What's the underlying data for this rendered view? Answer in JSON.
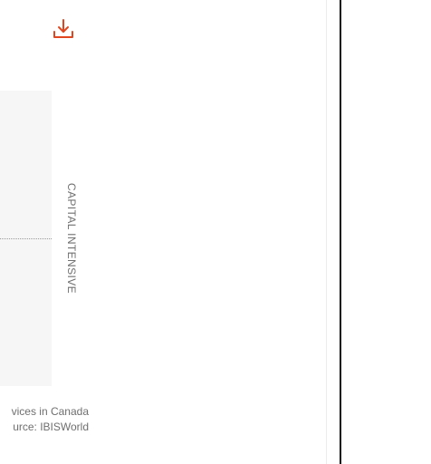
{
  "icons": {
    "download": "download-icon"
  },
  "colors": {
    "accent": "#e0461f",
    "plot_background": "#f6f6f6",
    "label_gray": "#707070",
    "divider": "#111111"
  },
  "chart": {
    "side_label": "CAPITAL INTENSIVE",
    "caption_line1": "vices in Canada",
    "caption_line2": "urce: IBISWorld"
  }
}
